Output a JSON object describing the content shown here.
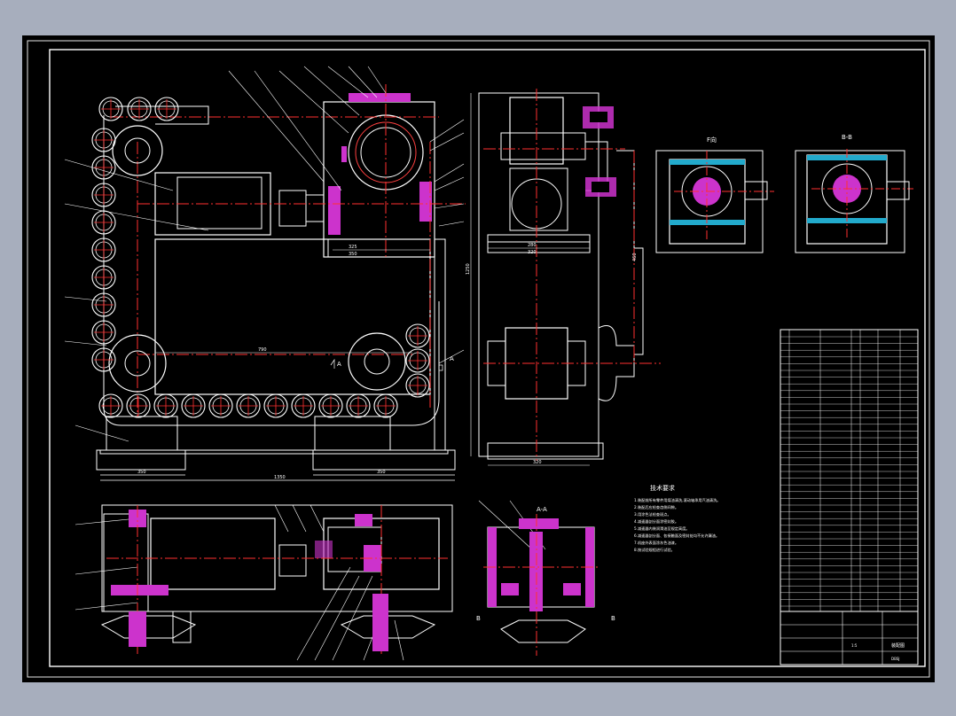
{
  "drawing": {
    "section_labels": {
      "a_a": "A-A",
      "b_b": "B-B",
      "f_view": "F向",
      "sec_a_left": "A",
      "sec_a_right": "A",
      "sec_b_left": "B",
      "sec_b_right": "B"
    },
    "dimensions": {
      "base_left": "350",
      "base_right": "350",
      "base_total": "1350",
      "center_dist": "790",
      "front_height": "1250",
      "side_width": "320",
      "gear_a": "325",
      "gear_b": "350",
      "gear_c": "280",
      "gear_d": "320",
      "side_vert": "460"
    },
    "tech_req": {
      "title": "技术要求",
      "lines": [
        "1.装配前所有零件用煤油清洗,滚动轴承用汽油清洗。",
        "2.装配后应检查齿侧间隙。",
        "3.用涂色法检查斑点。",
        "4.减速器剖分面涂密封胶。",
        "5.减速器内装润滑油至规定高度。",
        "6.减速器剖分面、各接触面及密封处均不允许漏油。",
        "7.机座外表面涂灰色油漆。",
        "8.按试验规程进行试验。"
      ]
    },
    "title_block": {
      "drawing_name": "装配图",
      "sheet_code": "DBSJ",
      "scale": "1:5"
    }
  }
}
